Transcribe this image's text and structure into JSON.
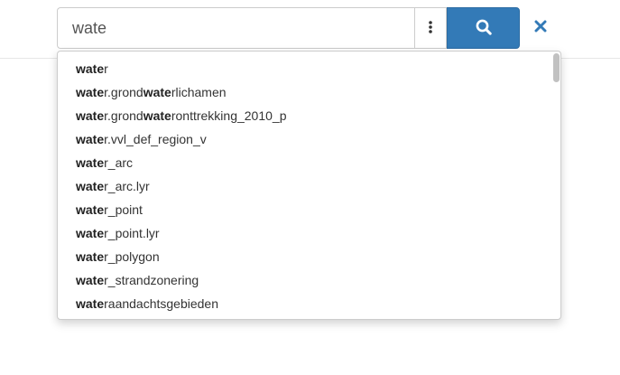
{
  "search": {
    "value": "wate",
    "placeholder": ""
  },
  "icons": {
    "menu": "vertical-ellipsis-icon",
    "search": "magnifier-icon",
    "clear": "close-x-icon"
  },
  "colors": {
    "primary": "#337ab7",
    "clear_icon": "#337ab7",
    "border": "#cccccc"
  },
  "suggestions": [
    {
      "parts": [
        {
          "t": "wate",
          "b": true
        },
        {
          "t": "r",
          "b": false
        }
      ]
    },
    {
      "parts": [
        {
          "t": "wate",
          "b": true
        },
        {
          "t": "r.grond",
          "b": false
        },
        {
          "t": "wate",
          "b": true
        },
        {
          "t": "rlichamen",
          "b": false
        }
      ]
    },
    {
      "parts": [
        {
          "t": "wate",
          "b": true
        },
        {
          "t": "r.grond",
          "b": false
        },
        {
          "t": "wate",
          "b": true
        },
        {
          "t": "ronttrekking_2010_p",
          "b": false
        }
      ]
    },
    {
      "parts": [
        {
          "t": "wate",
          "b": true
        },
        {
          "t": "r.vvl_def_region_v",
          "b": false
        }
      ]
    },
    {
      "parts": [
        {
          "t": "wate",
          "b": true
        },
        {
          "t": "r_arc",
          "b": false
        }
      ]
    },
    {
      "parts": [
        {
          "t": "wate",
          "b": true
        },
        {
          "t": "r_arc.lyr",
          "b": false
        }
      ]
    },
    {
      "parts": [
        {
          "t": "wate",
          "b": true
        },
        {
          "t": "r_point",
          "b": false
        }
      ]
    },
    {
      "parts": [
        {
          "t": "wate",
          "b": true
        },
        {
          "t": "r_point.lyr",
          "b": false
        }
      ]
    },
    {
      "parts": [
        {
          "t": "wate",
          "b": true
        },
        {
          "t": "r_polygon",
          "b": false
        }
      ]
    },
    {
      "parts": [
        {
          "t": "wate",
          "b": true
        },
        {
          "t": "r_strandzonering",
          "b": false
        }
      ]
    },
    {
      "parts": [
        {
          "t": "wate",
          "b": true
        },
        {
          "t": "raandachtsgebieden",
          "b": false
        }
      ]
    }
  ]
}
